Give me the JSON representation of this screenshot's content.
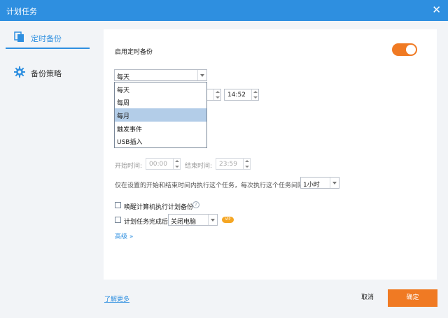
{
  "window": {
    "title": "计划任务",
    "close_label": "✕"
  },
  "sidebar": {
    "items": [
      {
        "label": "定时备份",
        "icon": "copy-icon",
        "active": true
      },
      {
        "label": "备份策略",
        "icon": "gear-icon",
        "active": false
      }
    ]
  },
  "schedule": {
    "enable_label": "启用定时备份",
    "enabled": true,
    "frequency": {
      "value": "每天",
      "options": [
        "每天",
        "每周",
        "每月",
        "触发事件",
        "USB插入"
      ],
      "highlighted": "每月"
    },
    "time": "14:52",
    "start_label": "开始时间:",
    "start_value": "00:00",
    "end_label": "结束时间:",
    "end_value": "23:59",
    "interval_desc": "仅在设置的开始和结束时间内执行这个任务，每次执行这个任务间隔:",
    "interval_value": "1小时"
  },
  "options": {
    "wake_label": "唤醒计算机执行计划备份",
    "wake_checked": false,
    "after_label": "计划任务完成后",
    "after_checked": false,
    "after_action": "关闭电脑",
    "vip_badge": "VIP",
    "advanced_label": "高级 »"
  },
  "footer": {
    "learn_more": "了解更多",
    "cancel": "取消",
    "ok": "确定"
  },
  "colors": {
    "accent": "#2e8fe0",
    "orange": "#f07a23"
  }
}
